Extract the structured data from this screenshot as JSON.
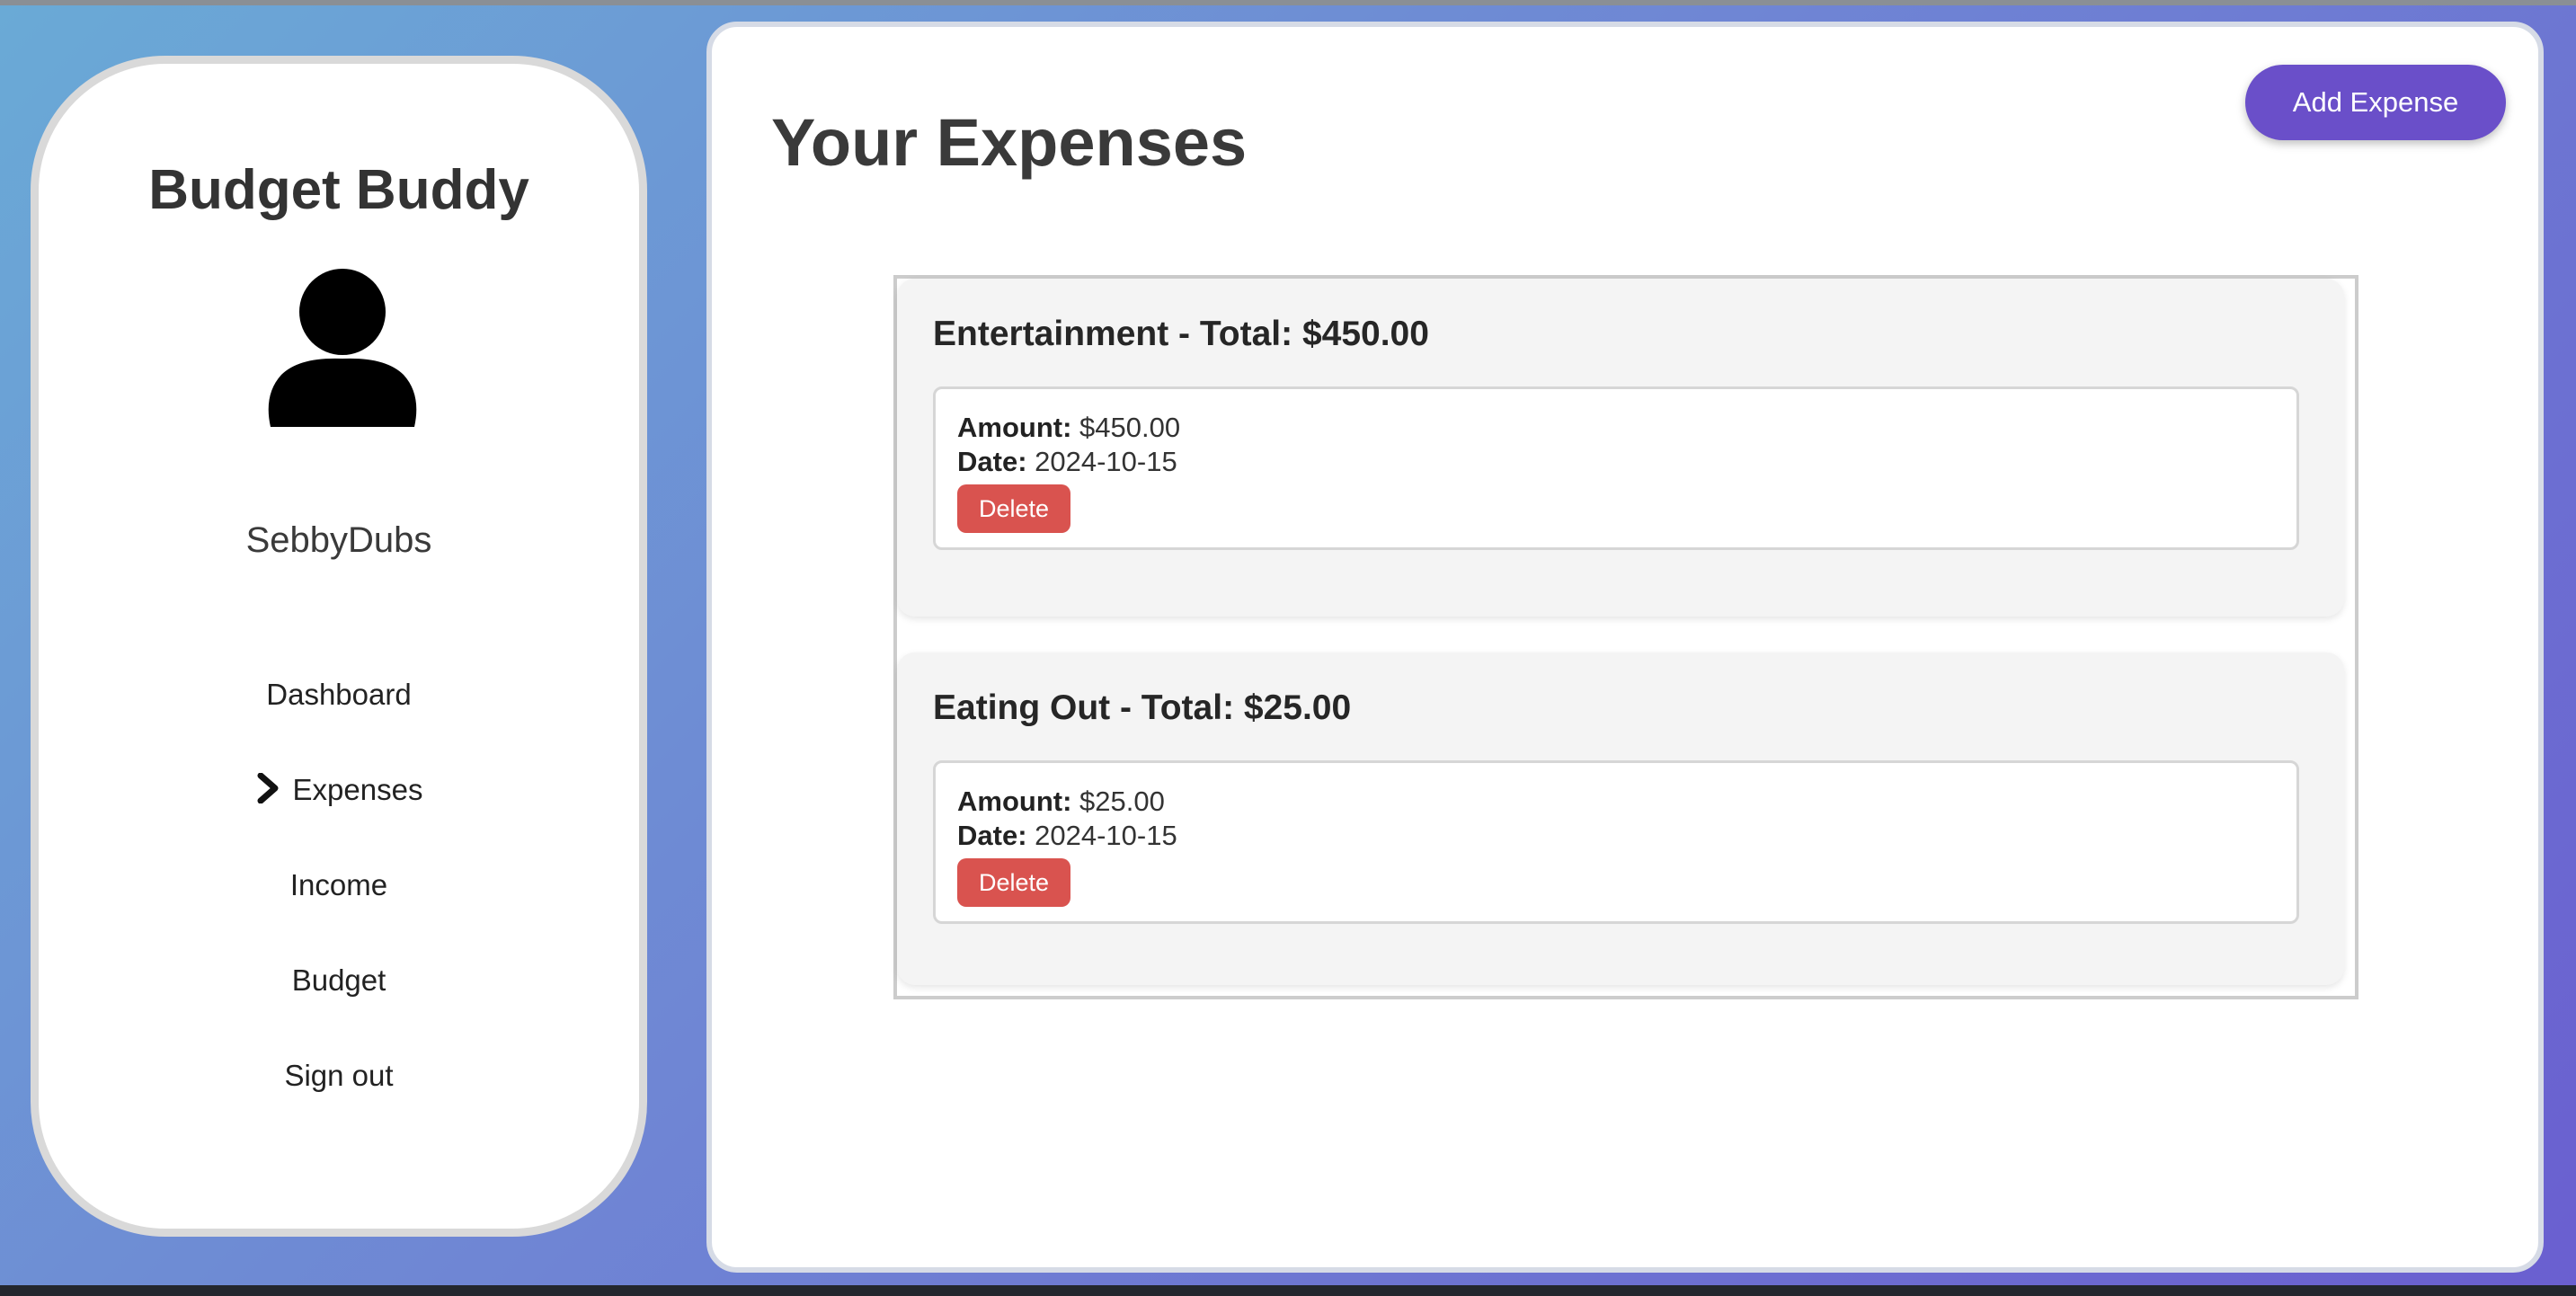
{
  "sidebar": {
    "brand": "Budget Buddy",
    "username": "SebbyDubs",
    "items": [
      {
        "label": "Dashboard",
        "active": false
      },
      {
        "label": "Expenses",
        "active": true
      },
      {
        "label": "Income",
        "active": false
      },
      {
        "label": "Budget",
        "active": false
      },
      {
        "label": "Sign out",
        "active": false
      }
    ]
  },
  "main": {
    "title": "Your Expenses",
    "add_button": "Add Expense",
    "categories": [
      {
        "title": "Entertainment - Total: $450.00",
        "entries": [
          {
            "amount_label": "Amount:",
            "amount": "$450.00",
            "date_label": "Date:",
            "date": "2024-10-15",
            "delete_label": "Delete"
          }
        ]
      },
      {
        "title": "Eating Out - Total: $25.00",
        "entries": [
          {
            "amount_label": "Amount:",
            "amount": "$25.00",
            "date_label": "Date:",
            "date": "2024-10-15",
            "delete_label": "Delete"
          }
        ]
      }
    ]
  },
  "colors": {
    "accent": "#6a4fc9",
    "danger": "#d9534f",
    "background_start": "#6aaad6",
    "background_end": "#6a5fd0"
  },
  "icons": {
    "avatar": "user-avatar-icon",
    "active_marker": "chevron-right-icon"
  }
}
